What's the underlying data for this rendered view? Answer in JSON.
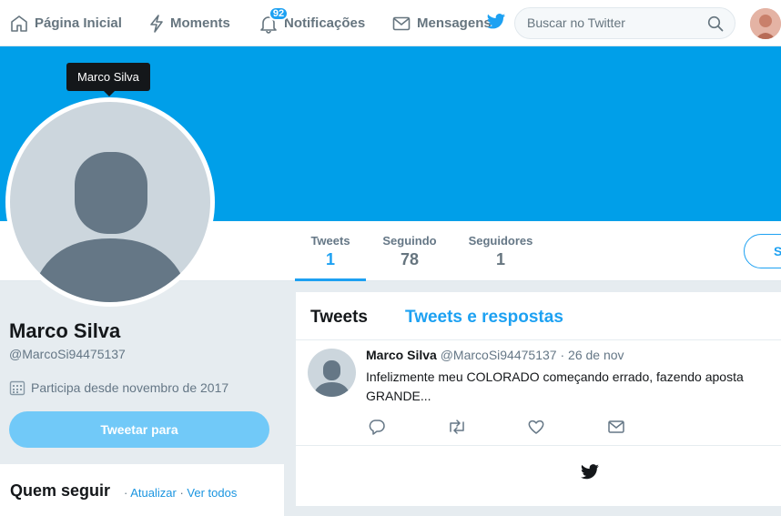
{
  "nav": {
    "home": "Página Inicial",
    "moments": "Moments",
    "notifications": "Notificações",
    "notifications_count": "92",
    "messages": "Mensagens",
    "search_placeholder": "Buscar no Twitter"
  },
  "tooltip": "Marco Silva",
  "profile": {
    "name": "Marco Silva",
    "handle": "@MarcoSi94475137",
    "joined": "Participa desde novembro de 2017",
    "tweet_to_button": "Tweetar para",
    "follow_button": "S"
  },
  "stats": {
    "tweets_label": "Tweets",
    "tweets_value": "1",
    "following_label": "Seguindo",
    "following_value": "78",
    "followers_label": "Seguidores",
    "followers_value": "1"
  },
  "who_to_follow": {
    "title": "Quem seguir",
    "sep1": "·",
    "refresh": "Atualizar",
    "sep2": "·",
    "view_all": "Ver todos"
  },
  "timeline": {
    "tab_tweets": "Tweets",
    "tab_replies": "Tweets e respostas",
    "tweet": {
      "name": "Marco Silva",
      "handle": "@MarcoSi94475137",
      "dot": "·",
      "date": "26 de nov",
      "text": "Infelizmente meu COLORADO começando errado, fazendo aposta GRANDE..."
    }
  },
  "colors": {
    "accent": "#1da1f2",
    "banner": "#009fe9",
    "tweet_button": "#71c9f8"
  },
  "icons": [
    "home-icon",
    "lightning-icon",
    "bell-icon",
    "envelope-icon",
    "twitter-bird-icon",
    "search-icon",
    "calendar-icon",
    "reply-icon",
    "retweet-icon",
    "heart-icon",
    "dm-icon"
  ]
}
